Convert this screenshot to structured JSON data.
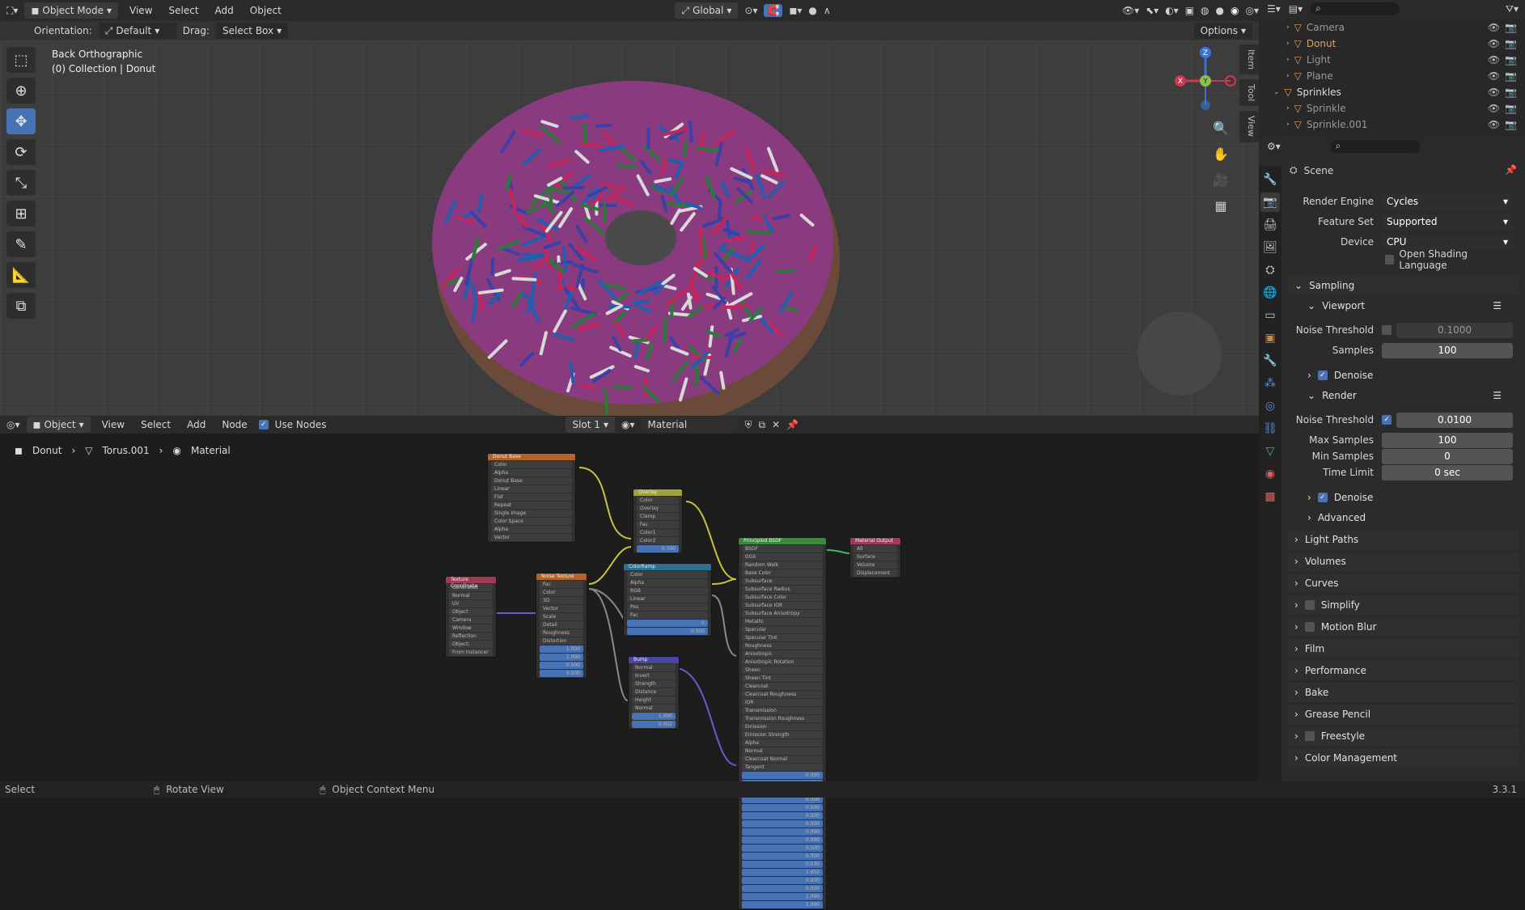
{
  "viewport_header": {
    "mode": "Object Mode",
    "menus": [
      "View",
      "Select",
      "Add",
      "Object"
    ],
    "transform": "Global"
  },
  "tool_header": {
    "orientation_label": "Orientation:",
    "orientation": "Default",
    "drag_label": "Drag:",
    "drag": "Select Box",
    "options": "Options"
  },
  "viewport": {
    "view_name": "Back Orthographic",
    "collection": "(0) Collection | Donut",
    "tabs": [
      "Item",
      "Tool",
      "View"
    ],
    "gizmo_axes": [
      "X",
      "Y",
      "Z"
    ]
  },
  "node_header": {
    "type": "Object",
    "menus": [
      "View",
      "Select",
      "Add",
      "Node"
    ],
    "use_nodes": "Use Nodes",
    "slot": "Slot 1",
    "material": "Material"
  },
  "breadcrumb": [
    "Donut",
    "Torus.001",
    "Material"
  ],
  "nodes": [
    {
      "title": "Donut Base",
      "rows": [
        "Color",
        "Alpha",
        "Donut Base",
        "Linear",
        "Flat",
        "Repeat",
        "Single Image",
        "Color Space",
        "Alpha",
        "Vector"
      ]
    },
    {
      "title": "Overlay",
      "rows": [
        "Color",
        "Overlay",
        "Clamp",
        "Fac",
        "Color1",
        "Color2"
      ],
      "fac_value": "0.700"
    },
    {
      "title": "Texture Coordinate",
      "rows": [
        "Generated",
        "Normal",
        "UV",
        "Object",
        "Camera",
        "Window",
        "Reflection",
        "Object:",
        "From Instancer"
      ]
    },
    {
      "title": "Noise Texture",
      "rows": [
        "Fac",
        "Color",
        "3D",
        "Vector",
        "Scale",
        "Detail",
        "Roughness",
        "Distortion"
      ],
      "values": [
        "1.000",
        "1.000",
        "0.500",
        "0.000"
      ]
    },
    {
      "title": "ColorRamp",
      "rows": [
        "Color",
        "Alpha",
        "RGB",
        "Linear",
        "Pos",
        "Fac"
      ],
      "values": [
        "0",
        "0.000"
      ]
    },
    {
      "title": "Bump",
      "rows": [
        "Normal",
        "Invert",
        "Strength",
        "Distance",
        "Height",
        "Normal"
      ],
      "values": [
        "1.000",
        "0.002"
      ]
    },
    {
      "title": "Principled BSDF",
      "rows": [
        "BSDF",
        "GGX",
        "Random Walk",
        "Base Color",
        "Subsurface",
        "Subsurface Radius",
        "Subsurface Color",
        "Subsurface IOR",
        "Subsurface Anisotropy",
        "Metallic",
        "Specular",
        "Specular Tint",
        "Roughness",
        "Anisotropic",
        "Anisotropic Rotation",
        "Sheen",
        "Sheen Tint",
        "Clearcoat",
        "Clearcoat Roughness",
        "IOR",
        "Transmission",
        "Transmission Roughness",
        "Emission",
        "Emission Strength",
        "Alpha",
        "Normal",
        "Clearcoat Normal",
        "Tangent"
      ],
      "values": [
        "0.000",
        "1.400",
        "0.000",
        "0.000",
        "0.500",
        "0.000",
        "0.000",
        "0.000",
        "0.000",
        "0.500",
        "0.000",
        "0.030",
        "1.450",
        "0.000",
        "0.000",
        "1.000",
        "1.000"
      ]
    },
    {
      "title": "Material Output",
      "rows": [
        "All",
        "Surface",
        "Volume",
        "Displacement"
      ]
    }
  ],
  "outliner": {
    "items": [
      {
        "name": "Camera",
        "indent": 1
      },
      {
        "name": "Donut",
        "indent": 1
      },
      {
        "name": "Light",
        "indent": 1
      },
      {
        "name": "Plane",
        "indent": 1
      },
      {
        "name": "Sprinkles",
        "indent": 0
      },
      {
        "name": "Sprinkle",
        "indent": 1
      },
      {
        "name": "Sprinkle.001",
        "indent": 1
      }
    ]
  },
  "props": {
    "context": "Scene",
    "render_engine_label": "Render Engine",
    "render_engine": "Cycles",
    "feature_set_label": "Feature Set",
    "feature_set": "Supported",
    "device_label": "Device",
    "device": "CPU",
    "osl": "Open Shading Language",
    "sampling": "Sampling",
    "viewport_sub": "Viewport",
    "noise_label": "Noise Threshold",
    "vp_noise": "0.1000",
    "samples_label": "Samples",
    "vp_samples": "100",
    "denoise": "Denoise",
    "render_sub": "Render",
    "r_noise": "0.0100",
    "max_samples_label": "Max Samples",
    "max_samples": "100",
    "min_samples_label": "Min Samples",
    "min_samples": "0",
    "time_limit_label": "Time Limit",
    "time_limit": "0 sec",
    "advanced": "Advanced",
    "sections": [
      "Light Paths",
      "Volumes",
      "Curves",
      "Simplify",
      "Motion Blur",
      "Film",
      "Performance",
      "Bake",
      "Grease Pencil",
      "Freestyle",
      "Color Management"
    ]
  },
  "status": {
    "left": "Select",
    "middle": "Rotate View",
    "right": "Object Context Menu",
    "version": "3.3.1"
  }
}
